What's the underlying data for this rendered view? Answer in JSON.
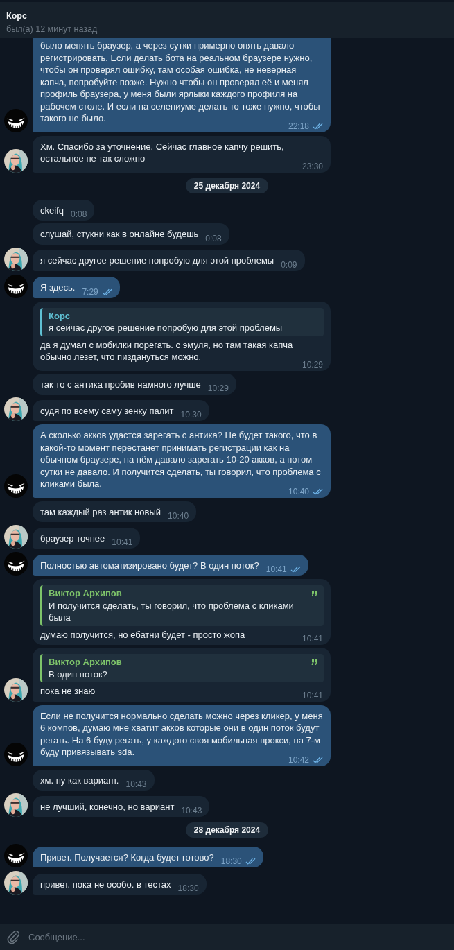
{
  "header": {
    "title": "Корс",
    "status": "был(а) 12 минут назад"
  },
  "messages": [
    {
      "kind": "message",
      "outgoing": true,
      "avatar": true,
      "read": true,
      "text": "было менять браузер, а через сутки примерно опять давало регистрировать. Если делать бота на реальном браузере нужно, чтобы он проверял ошибку, там особая ошибка, не неверная капча, попробуйте позже. Нужно чтобы он проверял её и менял профиль браузера, у меня были ярлыки каждого профиля на рабочем столе. И если на селениуме делать то тоже нужно, чтобы такого не было.",
      "time": "22:18"
    },
    {
      "kind": "message",
      "outgoing": false,
      "avatar": true,
      "text": "Хм. Спасибо за уточнение. Сейчас главное капчу решить, остальное не так сложно",
      "time": "23:30"
    },
    {
      "kind": "date",
      "text": "25 декабря 2024"
    },
    {
      "kind": "message",
      "outgoing": false,
      "avatar": false,
      "text": "ckeifq",
      "time": "0:08"
    },
    {
      "kind": "message",
      "outgoing": false,
      "avatar": false,
      "text": "слушай, стукни как в онлайне будешь",
      "time": "0:08"
    },
    {
      "kind": "message",
      "outgoing": false,
      "avatar": true,
      "text": "я сейчас другое решение попробую для этой проблемы",
      "time": "0:09"
    },
    {
      "kind": "message",
      "outgoing": true,
      "avatar": true,
      "read": true,
      "text": "Я здесь.",
      "time": "7:29"
    },
    {
      "kind": "message",
      "outgoing": false,
      "avatar": false,
      "quote": {
        "author": "Корс",
        "text": "я сейчас другое решение попробую для этой проблемы",
        "color": "#5fc0d3",
        "quote_mark": false
      },
      "text": "да я думал с мобилки порегать. с эмуля, но там такая капча обычно лезет, что пиздануться можно.",
      "time": "10:29"
    },
    {
      "kind": "message",
      "outgoing": false,
      "avatar": false,
      "text": "так то с антика пробив намного лучше",
      "time": "10:29"
    },
    {
      "kind": "message",
      "outgoing": false,
      "avatar": true,
      "text": "судя по всему саму зенку палит",
      "time": "10:30"
    },
    {
      "kind": "message",
      "outgoing": true,
      "avatar": true,
      "read": true,
      "text": "А сколько акков удастся зарегать с антика? Не будет такого, что в какой-то момент перестанет принимать регистрации как на обычном браузере, на нём давало зарегать 10-20 акков, а потом сутки не давало. И получится сделать, ты говорил, что проблема с кликами была.",
      "time": "10:40"
    },
    {
      "kind": "message",
      "outgoing": false,
      "avatar": false,
      "text": "там каждый раз антик новый",
      "time": "10:40"
    },
    {
      "kind": "message",
      "outgoing": false,
      "avatar": true,
      "text": "браузер точнее",
      "time": "10:41"
    },
    {
      "kind": "message",
      "outgoing": true,
      "avatar": true,
      "read": true,
      "text": "Полностью автоматизировано будет? В один поток?",
      "time": "10:41"
    },
    {
      "kind": "message",
      "outgoing": false,
      "avatar": false,
      "quote": {
        "author": "Виктор Архипов",
        "text": "И получится сделать, ты говорил, что проблема с кликами была",
        "color": "#7ec46a",
        "quote_mark": true
      },
      "text": "думаю получится, но ебатни будет - просто жопа",
      "time": "10:41"
    },
    {
      "kind": "message",
      "outgoing": false,
      "avatar": true,
      "quote": {
        "author": "Виктор Архипов",
        "text": "В один поток?",
        "color": "#7ec46a",
        "quote_mark": true
      },
      "text": "пока не знаю",
      "time": "10:41"
    },
    {
      "kind": "message",
      "outgoing": true,
      "avatar": true,
      "read": true,
      "text": "Если не получится нормально сделать можно через кликер, у меня 6 компов, думаю мне хватит акков которые они в один поток будут регать. На 6 буду регать, у каждого своя мобильная прокси, на 7-м буду привязывать sda.",
      "time": "10:42"
    },
    {
      "kind": "message",
      "outgoing": false,
      "avatar": false,
      "text": "хм. ну как вариант.",
      "time": "10:43"
    },
    {
      "kind": "message",
      "outgoing": false,
      "avatar": true,
      "text": "не лучший, конечно, но вариант",
      "time": "10:43"
    },
    {
      "kind": "date",
      "text": "28 декабря 2024"
    },
    {
      "kind": "message",
      "outgoing": true,
      "avatar": true,
      "read": true,
      "text": "Привет. Получается? Когда будет готово?",
      "time": "18:30"
    },
    {
      "kind": "message",
      "outgoing": false,
      "avatar": true,
      "text": "привет. пока не особо. в тестах",
      "time": "18:30"
    }
  ],
  "composer": {
    "placeholder": "Сообщение..."
  }
}
